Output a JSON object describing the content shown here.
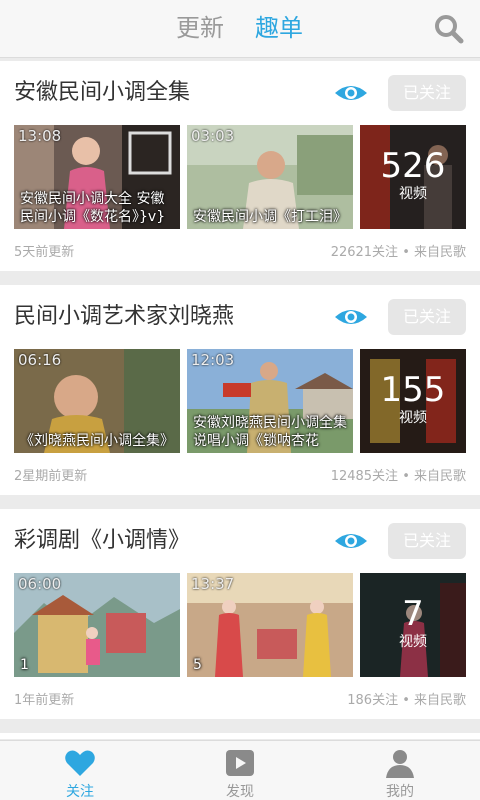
{
  "header": {
    "tabs": [
      {
        "label": "更新"
      },
      {
        "label": "趣单"
      }
    ],
    "active_tab": "趣单",
    "accent_color": "#2ea7e0"
  },
  "cards": [
    {
      "title": "安徽民间小调全集",
      "follow_label": "已关注",
      "videos": [
        {
          "duration": "13:08",
          "caption": "安徽民间小调大全 安徽民间小调《数花名》}v}"
        },
        {
          "duration": "03:03",
          "caption": "安徽民间小调《打工泪》"
        }
      ],
      "count": "526",
      "count_unit": "视频",
      "updated": "5天前更新",
      "stats": "22621关注 • 来自民歌"
    },
    {
      "title": "民间小调艺术家刘晓燕",
      "follow_label": "已关注",
      "videos": [
        {
          "duration": "06:16",
          "caption": "《刘晓燕民间小调全集》"
        },
        {
          "duration": "12:03",
          "caption": "安徽刘晓燕民间小调全集 说唱小调《锁呐杏花"
        }
      ],
      "count": "155",
      "count_unit": "视频",
      "updated": "2星期前更新",
      "stats": "12485关注 • 来自民歌"
    },
    {
      "title": "彩调剧《小调情》",
      "follow_label": "已关注",
      "videos": [
        {
          "duration": "06:00",
          "caption": "1"
        },
        {
          "duration": "13:37",
          "caption": "5"
        }
      ],
      "count": "7",
      "count_unit": "视频",
      "updated": "1年前更新",
      "stats": "186关注 • 来自民歌"
    }
  ],
  "bottom_nav": [
    {
      "label": "关注",
      "icon": "heart-icon"
    },
    {
      "label": "发现",
      "icon": "play-icon"
    },
    {
      "label": "我的",
      "icon": "user-icon"
    }
  ],
  "active_nav": "关注"
}
